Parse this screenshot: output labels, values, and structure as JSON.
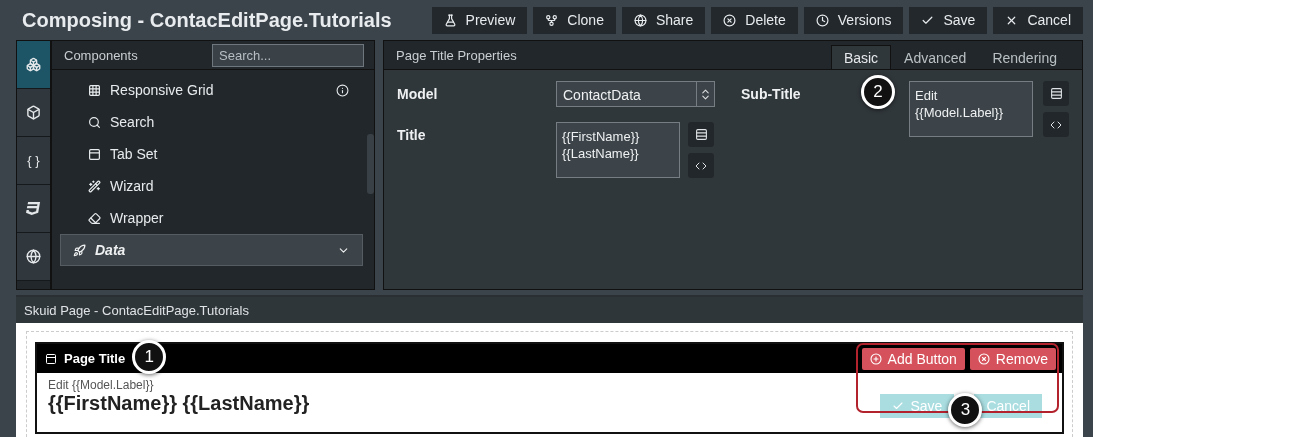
{
  "title": "Composing - ContacEditPage.Tutorials",
  "toolbar": [
    "Preview",
    "Clone",
    "Share",
    "Delete",
    "Versions",
    "Save",
    "Cancel"
  ],
  "rail": [
    {
      "kind": "icon",
      "selected": true
    },
    {
      "kind": "icon",
      "selected": false
    },
    {
      "kind": "text",
      "label": "{ }",
      "selected": false
    },
    {
      "kind": "icon",
      "selected": false
    },
    {
      "kind": "icon",
      "selected": false
    }
  ],
  "components": {
    "title": "Components",
    "search_placeholder": "Search...",
    "items": [
      {
        "kind": "item",
        "label": "Responsive Grid",
        "info": true
      },
      {
        "kind": "item",
        "label": "Search",
        "info": false
      },
      {
        "kind": "item",
        "label": "Tab Set",
        "info": false
      },
      {
        "kind": "item",
        "label": "Wizard",
        "info": false
      },
      {
        "kind": "item",
        "label": "Wrapper",
        "info": false
      },
      {
        "kind": "section",
        "label": "Data"
      }
    ]
  },
  "properties": {
    "title": "Page Title Properties",
    "tabs": [
      {
        "label": "Basic",
        "selected": true
      },
      {
        "label": "Advanced",
        "selected": false
      },
      {
        "label": "Rendering",
        "selected": false
      }
    ],
    "fields": [
      {
        "label": "Model",
        "kind": "select",
        "value": "ContactData"
      },
      {
        "label": "Title",
        "kind": "textarea",
        "value": "{{FirstName}}\n{{LastName}}"
      }
    ],
    "subtitle": {
      "label": "Sub-Title",
      "value": "Edit\n{{Model.Label}}"
    }
  },
  "canvas": {
    "title": "Skuid Page - ContacEditPage.Tutorials",
    "component": {
      "label": "Page Title",
      "actions": [
        "Add Button",
        "Remove"
      ],
      "subtitle": "Edit {{Model.Label}}",
      "heading": "{{FirstName}} {{LastName}}",
      "buttons": [
        "Save",
        "Cancel"
      ]
    }
  },
  "callouts": [
    "1",
    "2",
    "3"
  ]
}
